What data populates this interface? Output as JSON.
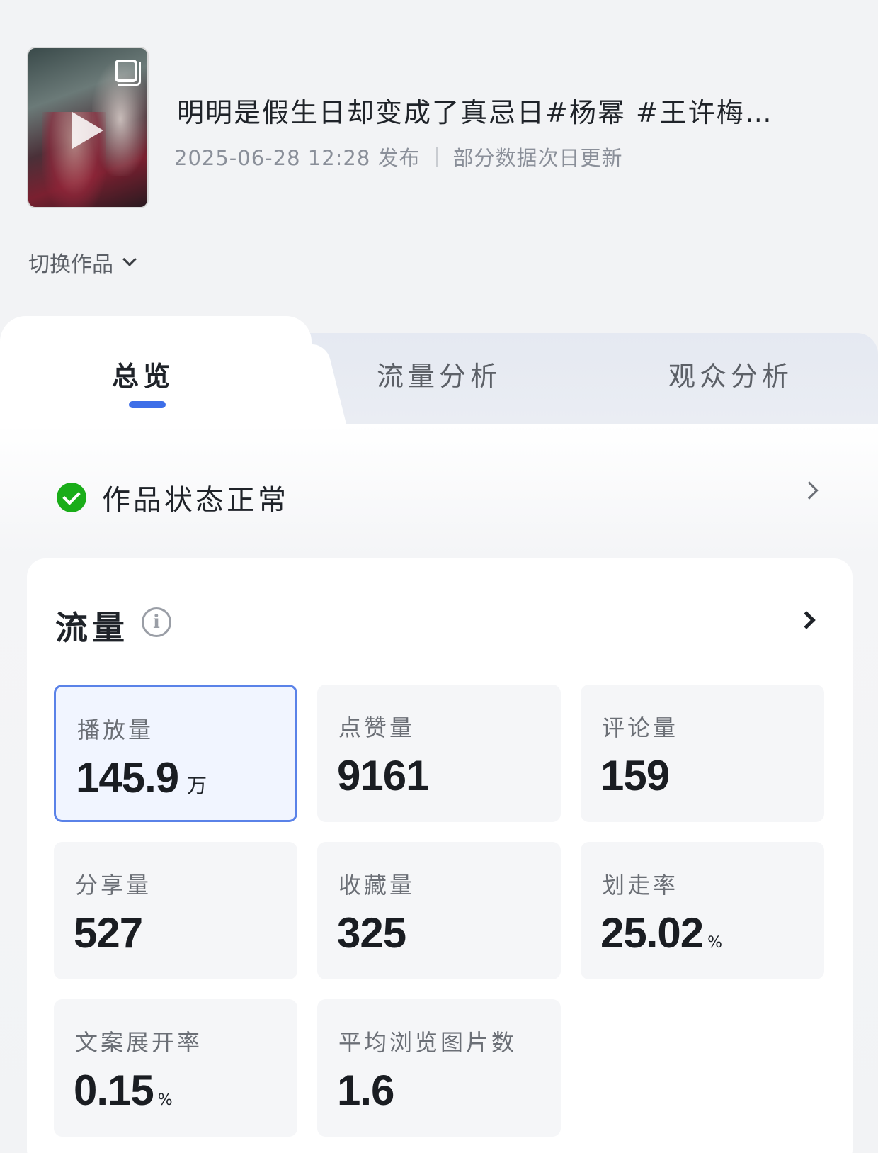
{
  "video": {
    "title": "明明是假生日却变成了真忌日#杨幂 #王许梅…",
    "publish_time": "2025-06-28 12:28 发布",
    "update_note": "部分数据次日更新",
    "thumbnail_icon": "multi-image-icon",
    "play_icon": "play-icon"
  },
  "switch_work": {
    "label": "切换作品"
  },
  "tabs": [
    {
      "label": "总览",
      "active": true
    },
    {
      "label": "流量分析",
      "active": false
    },
    {
      "label": "观众分析",
      "active": false
    }
  ],
  "status": {
    "label": "作品状态正常",
    "color": "#1aad19"
  },
  "traffic": {
    "title": "流量",
    "metrics": [
      {
        "label": "播放量",
        "value": "145.9",
        "unit": "万",
        "selected": true
      },
      {
        "label": "点赞量",
        "value": "9161",
        "unit": ""
      },
      {
        "label": "评论量",
        "value": "159",
        "unit": ""
      },
      {
        "label": "分享量",
        "value": "527",
        "unit": ""
      },
      {
        "label": "收藏量",
        "value": "325",
        "unit": ""
      },
      {
        "label": "划走率",
        "value": "25.02",
        "unit": "%"
      },
      {
        "label": "文案展开率",
        "value": "0.15",
        "unit": "%"
      },
      {
        "label": "平均浏览图片数",
        "value": "1.6",
        "unit": ""
      }
    ]
  },
  "colors": {
    "accent": "#3d6ee8",
    "selected_border": "#5a82e8",
    "selected_bg": "#f1f5ff"
  }
}
